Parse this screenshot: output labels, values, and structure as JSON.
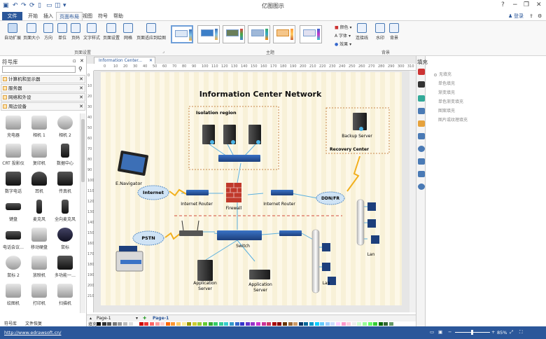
{
  "window": {
    "title": "亿图图示"
  },
  "quick_access": [
    "↶",
    "↷",
    "⟳",
    "▯",
    "▭",
    "◫",
    "▾"
  ],
  "window_buttons": [
    "?",
    "−",
    "❐",
    "✕"
  ],
  "menu": {
    "file": "文件",
    "tabs": [
      "开始",
      "插入",
      "页面布局",
      "视图",
      "符号",
      "帮助"
    ],
    "active": "页面布局",
    "login": "登录"
  },
  "ribbon": {
    "page_setup": {
      "label": "页面设置",
      "buttons": [
        "自动扩展",
        "页面大小",
        "方向",
        "单位",
        "页码",
        "文字样式",
        "页面设置",
        "网格",
        "页面适应到绘图"
      ]
    },
    "theme": {
      "label": "主题"
    },
    "colors": [
      "颜色",
      "字体",
      "效果"
    ],
    "connector": "连接线",
    "background": {
      "label": "背景",
      "buttons": [
        "水印",
        "背景"
      ]
    }
  },
  "library": {
    "title": "符号库",
    "categories": [
      "计算机和显示器",
      "服务器",
      "网络和外设",
      "周边设备"
    ],
    "shapes": [
      "充电器",
      "相机 1",
      "相机 2",
      "CRT 投影仪",
      "复印机",
      "数据中心",
      "数字电话",
      "耳机",
      "传真机",
      "键盘",
      "麦克风",
      "全向麦克风",
      "电话会议…",
      "移动硬盘",
      "鼠标",
      "鼠标 2",
      "放映机",
      "多功能一…",
      "绘图机",
      "打印机",
      "扫描机"
    ],
    "tabs": [
      "符号库",
      "文件恢复"
    ]
  },
  "document": {
    "tab": "Information Center...",
    "page_tab": "Page-1",
    "active_page": "Page-1",
    "fill_label": "填充"
  },
  "ruler": {
    "h": [
      "0",
      "10",
      "20",
      "30",
      "40",
      "50",
      "60",
      "70",
      "80",
      "90",
      "100",
      "110",
      "120",
      "130",
      "140",
      "150",
      "160",
      "170",
      "180",
      "190",
      "200",
      "210",
      "220",
      "230",
      "240",
      "250",
      "260",
      "270",
      "280",
      "290",
      "300",
      "310"
    ],
    "v": [
      "0",
      "10",
      "20",
      "30",
      "40",
      "50",
      "60",
      "70",
      "80",
      "90",
      "100",
      "110",
      "120",
      "130",
      "140",
      "150",
      "160",
      "170",
      "180",
      "190",
      "200",
      "210"
    ]
  },
  "diagram": {
    "title": "Information Center Network",
    "isolation_label": "Isolation region",
    "recovery_label": "Recovery Center",
    "backup_server": "Backup Server",
    "e_navigator": "E.Navigator",
    "internet": "Internet",
    "internet_router_1": "Internet Router",
    "firewall": "Firewall",
    "internet_router_2": "Internet Router",
    "ddnfr": "DDN/FR",
    "pstn": "PSTN",
    "switch": "Switch",
    "app_server_1": "Application Server",
    "app_server_2": "Application Server",
    "lan_1": "Lan",
    "lan_2": "Lan",
    "colors": {
      "blue": "#2b579a",
      "firewall": "#c0392b",
      "lightning": "#f2b01e",
      "cloud": "#cfe3f5"
    }
  },
  "fill_panel": {
    "title": "填充",
    "options": [
      "无填充",
      "单色填充",
      "渐变填充",
      "单色渐变填充",
      "图案填充",
      "图片或纹理填充"
    ]
  },
  "status": {
    "url": "http://www.edrawsoft.cn/",
    "zoom": "85%"
  }
}
